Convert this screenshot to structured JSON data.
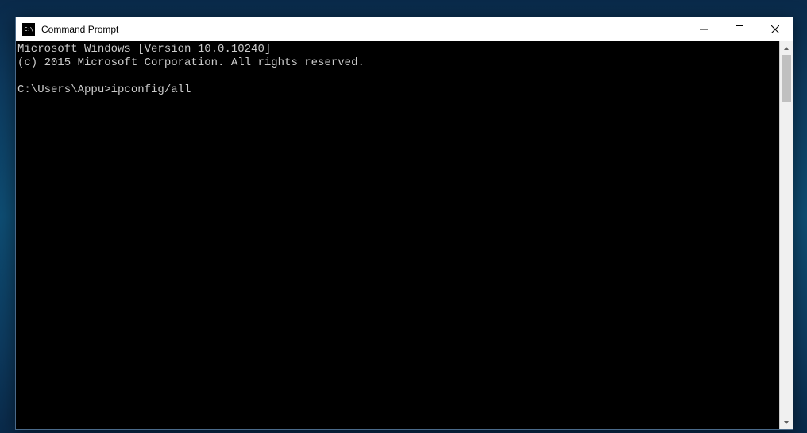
{
  "window": {
    "title": "Command Prompt",
    "icon_text": "C:\\"
  },
  "terminal": {
    "lines": [
      "Microsoft Windows [Version 10.0.10240]",
      "(c) 2015 Microsoft Corporation. All rights reserved.",
      "",
      "C:\\Users\\Appu>ipconfig/all"
    ]
  }
}
